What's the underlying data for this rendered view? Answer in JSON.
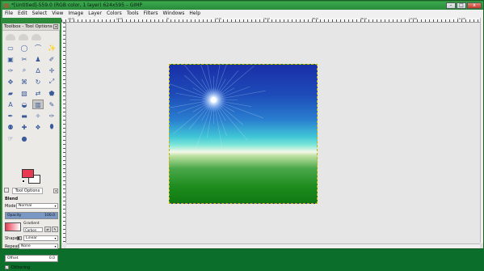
{
  "window": {
    "title": "*[Untitled]-559.0 (RGB color, 1 layer) 624x595 – GIMP",
    "controls": [
      "–",
      "□",
      "x"
    ]
  },
  "menubar": {
    "items": [
      "File",
      "Edit",
      "Select",
      "View",
      "Image",
      "Layer",
      "Colors",
      "Tools",
      "Filters",
      "Windows",
      "Help"
    ]
  },
  "toolbox": {
    "title": "Toolbox - Tool Options",
    "tools": [
      {
        "name": "rect-select",
        "glyph": "▭"
      },
      {
        "name": "ellipse-select",
        "glyph": "◯"
      },
      {
        "name": "free-select",
        "glyph": "⌒"
      },
      {
        "name": "fuzzy-select",
        "glyph": "✨"
      },
      {
        "name": "color-select",
        "glyph": "▣"
      },
      {
        "name": "scissors",
        "glyph": "✂"
      },
      {
        "name": "foreground-select",
        "glyph": "♟"
      },
      {
        "name": "paths",
        "glyph": "✐"
      },
      {
        "name": "color-picker",
        "glyph": "✑"
      },
      {
        "name": "zoom",
        "glyph": "⌕"
      },
      {
        "name": "measure",
        "glyph": "∆"
      },
      {
        "name": "move",
        "glyph": "✛"
      },
      {
        "name": "align",
        "glyph": "✥"
      },
      {
        "name": "crop",
        "glyph": "⌘"
      },
      {
        "name": "rotate",
        "glyph": "↻"
      },
      {
        "name": "scale",
        "glyph": "⤢"
      },
      {
        "name": "shear",
        "glyph": "▰"
      },
      {
        "name": "perspective",
        "glyph": "▧"
      },
      {
        "name": "flip",
        "glyph": "⇄"
      },
      {
        "name": "cage",
        "glyph": "⬟"
      },
      {
        "name": "text",
        "glyph": "A"
      },
      {
        "name": "bucket-fill",
        "glyph": "◒"
      },
      {
        "name": "blend",
        "glyph": "▥"
      },
      {
        "name": "pencil",
        "glyph": "✎"
      },
      {
        "name": "paintbrush",
        "glyph": "✒"
      },
      {
        "name": "eraser",
        "glyph": "▬"
      },
      {
        "name": "airbrush",
        "glyph": "✧"
      },
      {
        "name": "ink",
        "glyph": "✑"
      },
      {
        "name": "clone",
        "glyph": "⚉"
      },
      {
        "name": "heal",
        "glyph": "✚"
      },
      {
        "name": "perspective-clone",
        "glyph": "❖"
      },
      {
        "name": "blur",
        "glyph": "⬮"
      },
      {
        "name": "smudge",
        "glyph": "☞"
      },
      {
        "name": "dodge-burn",
        "glyph": "●"
      }
    ],
    "active_tool": "blend",
    "fg_color": "#e83a52",
    "bg_color": "#ffffff"
  },
  "tool_options": {
    "tab_label": "Tool Options",
    "section": "Blend",
    "mode_label": "Mode:",
    "mode_value": "Normal",
    "opacity_label": "Opacity",
    "opacity_value": "100.0",
    "gradient_label": "Gradient",
    "gradient_name": "Carbon",
    "shape_label": "Shape:",
    "shape_value": "Linear",
    "repeat_label": "Repeat:",
    "repeat_value": "None",
    "offset_label": "Offset",
    "offset_value": "0.0",
    "dithering_label": "Dithering",
    "dithering_checked": true
  },
  "ruler": {
    "labels": [
      "|400",
      "|200",
      "|0",
      "|200",
      "|400",
      "|600",
      "|800",
      "|1000",
      "|1200"
    ]
  },
  "canvas": {
    "background": "#e6e6e6"
  }
}
